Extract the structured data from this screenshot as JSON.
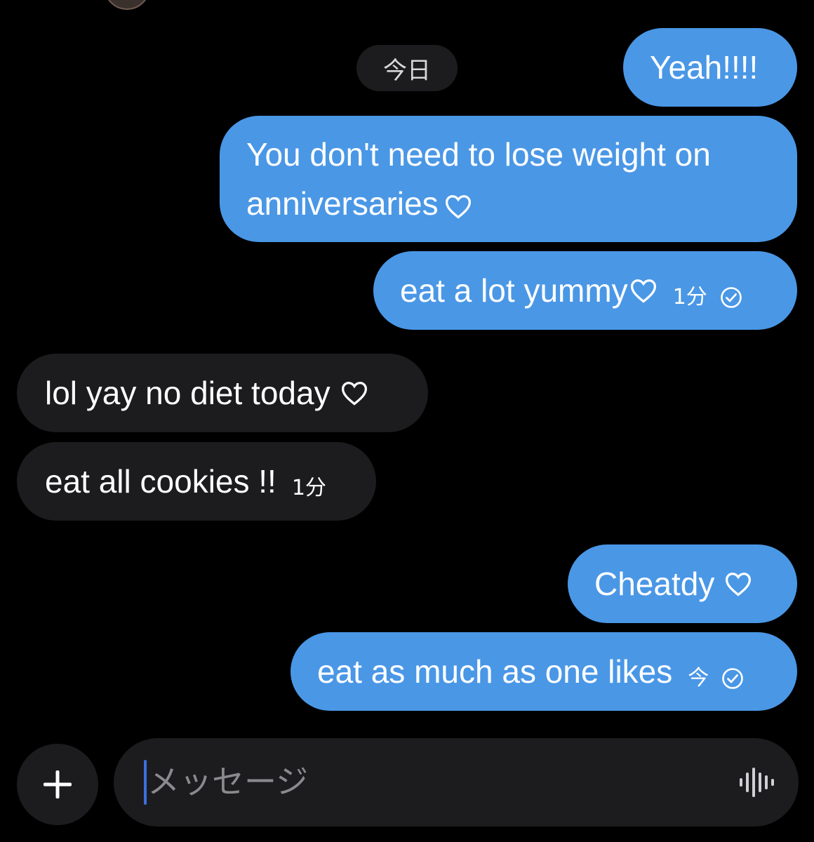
{
  "header": {
    "date_label": "今日"
  },
  "messages": [
    {
      "direction": "out",
      "text": "Yeah!!!!"
    },
    {
      "direction": "out",
      "text": "You don't need to lose weight on anniversaries"
    },
    {
      "direction": "out",
      "text": "eat a lot yummy",
      "time": "1分",
      "status": "read"
    },
    {
      "direction": "in",
      "text": "lol yay no diet today"
    },
    {
      "direction": "in",
      "text": "eat all cookies !!",
      "time": "1分"
    },
    {
      "direction": "out",
      "text": "Cheatdy"
    },
    {
      "direction": "out",
      "text": "eat as much as one likes",
      "time": "今",
      "status": "read"
    }
  ],
  "composer": {
    "placeholder": "メッセージ",
    "add_icon": "plus-icon",
    "voice_icon": "waveform-icon"
  },
  "colors": {
    "background": "#000000",
    "outgoing_bubble": "#4a97e6",
    "incoming_bubble": "#1c1c1e",
    "caret": "#3b6fe0"
  }
}
